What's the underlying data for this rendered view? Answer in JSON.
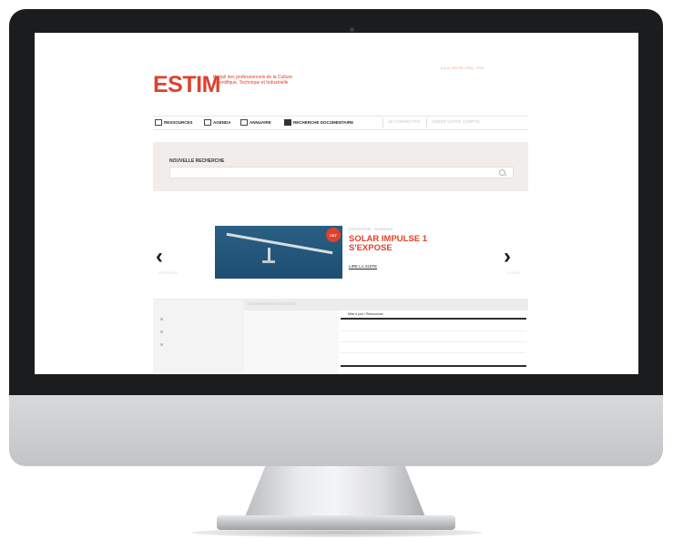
{
  "site": {
    "logo": "ESTIM",
    "tagline": "Portail des professionnels de la Culture Scientifique, Technique et Industrielle",
    "top_links": "A A A | EN FR | FAQ · RSS"
  },
  "nav": {
    "items": [
      {
        "label": "RESSOURCES",
        "icon": "resources-icon"
      },
      {
        "label": "AGENDA",
        "icon": "agenda-icon"
      },
      {
        "label": "ANNUAIRE",
        "icon": "directory-icon"
      },
      {
        "label": "RECHERCHE DOCUMENTAIRE",
        "icon": "document-search-icon"
      }
    ],
    "faded_items": [
      {
        "label": "SE CONNECTER"
      },
      {
        "label": "CRÉER VOTRE COMPTE"
      }
    ]
  },
  "search": {
    "title": "NOUVELLE RECHERCHE",
    "placeholder": ""
  },
  "carousel": {
    "prev_caption": "PRÉCÉDENT",
    "next_caption": "SUIVANT",
    "meta": "EXPOSITION · SCIENCES",
    "title": "SOLAR IMPULSE 1 S'EXPOSE",
    "link": "LIRE LA SUITE",
    "badge": "CST"
  },
  "lower": {
    "header": "LES DERNIÈRES RESSOURCES",
    "bar_label": "Mise à jour / Ressources"
  },
  "colors": {
    "brand": "#e0412b",
    "bezel": "#1b1c1e",
    "panel": "#f0edeb"
  }
}
